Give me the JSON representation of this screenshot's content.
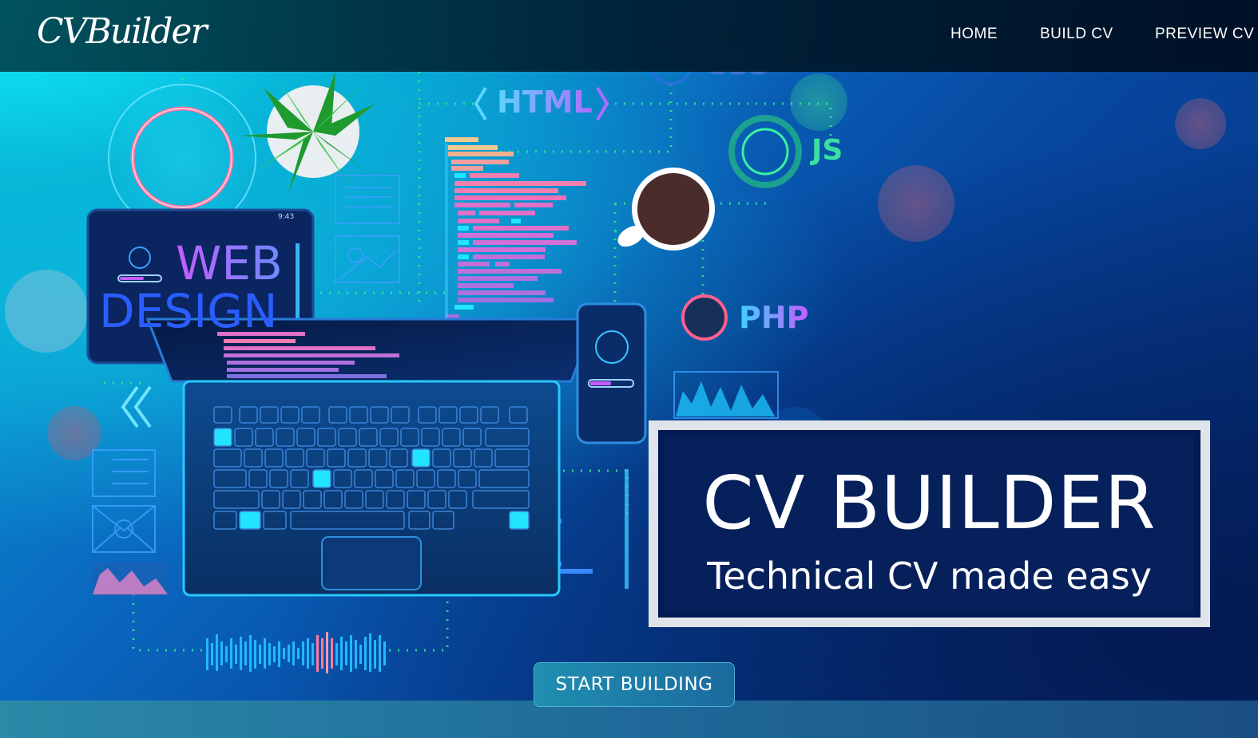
{
  "navbar": {
    "logo_text": "CVBuilder",
    "links": [
      {
        "label": "HOME"
      },
      {
        "label": "BUILD CV"
      },
      {
        "label": "PREVIEW CV"
      }
    ]
  },
  "hero_art": {
    "tech_labels": {
      "html": "HTML",
      "css": "CSS",
      "js": "JS",
      "php": "PHP",
      "web": "WEB",
      "design": "DESIGN"
    },
    "phone_time": "9:43"
  },
  "hero": {
    "title": "CV BUILDER",
    "subtitle": "Technical CV made easy",
    "cta_label": "START BUILDING"
  },
  "colors": {
    "navbar": "#01202f",
    "title_box_bg": "#06205c",
    "title_box_border": "#dfe4ea",
    "cta_bg": "#1f8fb0",
    "accent_cyan": "#0ff2ff"
  }
}
